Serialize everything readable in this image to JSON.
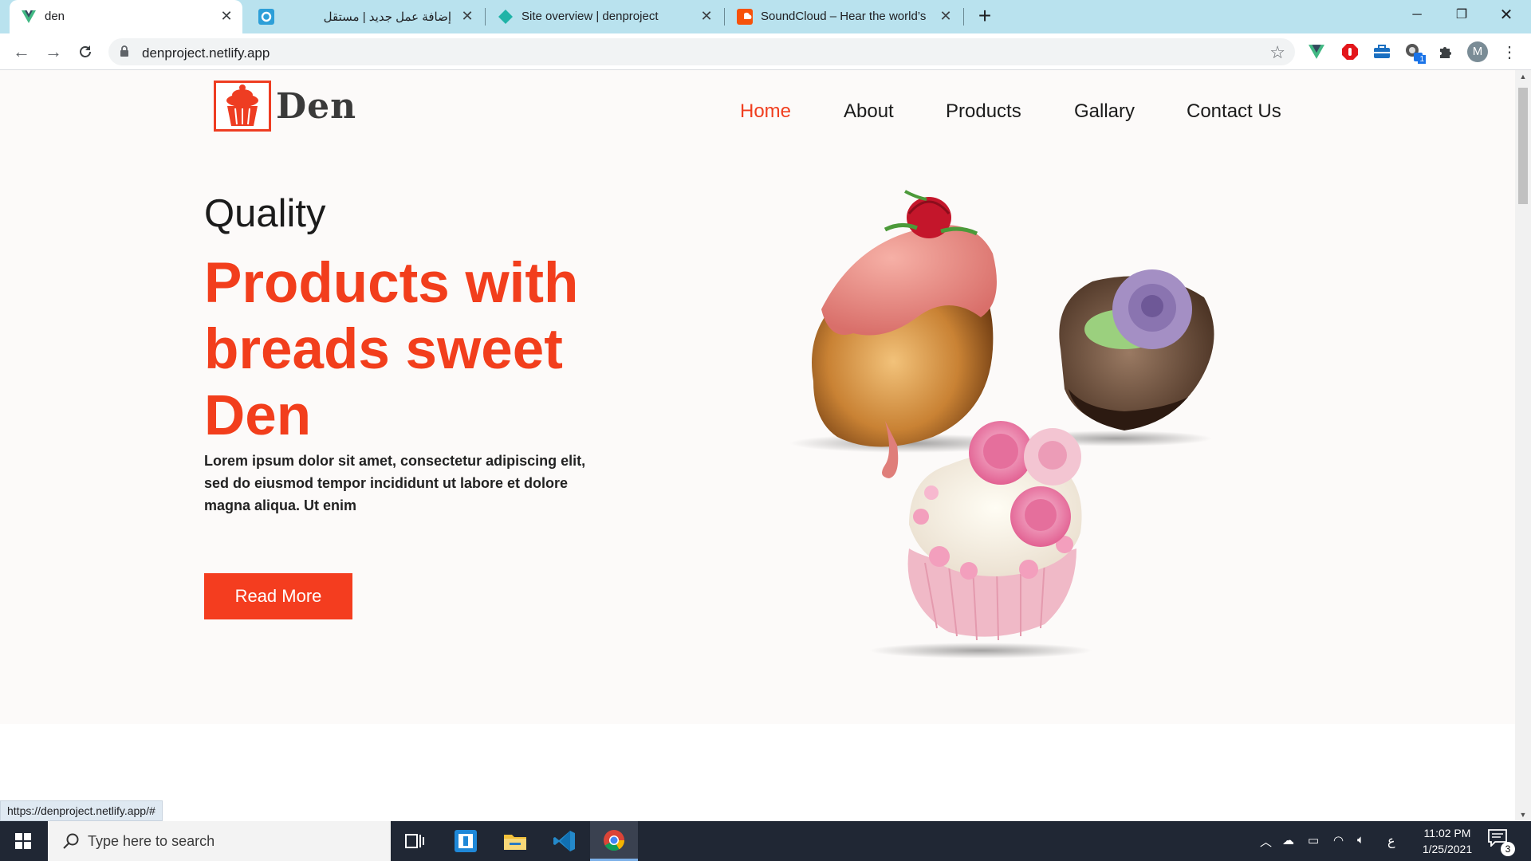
{
  "browser": {
    "tabs": [
      {
        "title": "den",
        "icon": "vue-icon",
        "active": true
      },
      {
        "title": "إضافة عمل جديد | مستقل",
        "icon": "mostaql-icon",
        "active": false
      },
      {
        "title": "Site overview | denproject",
        "icon": "netlify-icon",
        "active": false
      },
      {
        "title": "SoundCloud – Hear the world’s sounds",
        "icon": "soundcloud-icon",
        "active": false
      }
    ],
    "new_tab": "+",
    "url": "denproject.netlify.app",
    "profile_initial": "M",
    "status_url": "https://denproject.netlify.app/#",
    "extension_badge": "1"
  },
  "page": {
    "logo_text": "Den",
    "nav": [
      {
        "label": "Home",
        "active": true
      },
      {
        "label": "About",
        "active": false
      },
      {
        "label": "Products",
        "active": false
      },
      {
        "label": "Gallary",
        "active": false
      },
      {
        "label": "Contact Us",
        "active": false
      }
    ],
    "hero_kicker": "Quality",
    "hero_title": "Products with breads sweet Den",
    "hero_text": "Lorem ipsum dolor sit amet, consectetur adipiscing elit, sed do eiusmod tempor incididunt ut labore et dolore magna aliqua. Ut enim",
    "cta_label": "Read More",
    "accent_color": "#f23e1c"
  },
  "taskbar": {
    "search_placeholder": "Type here to search",
    "time": "11:02 PM",
    "date": "1/25/2021",
    "language": "ع",
    "notification_count": "3"
  }
}
